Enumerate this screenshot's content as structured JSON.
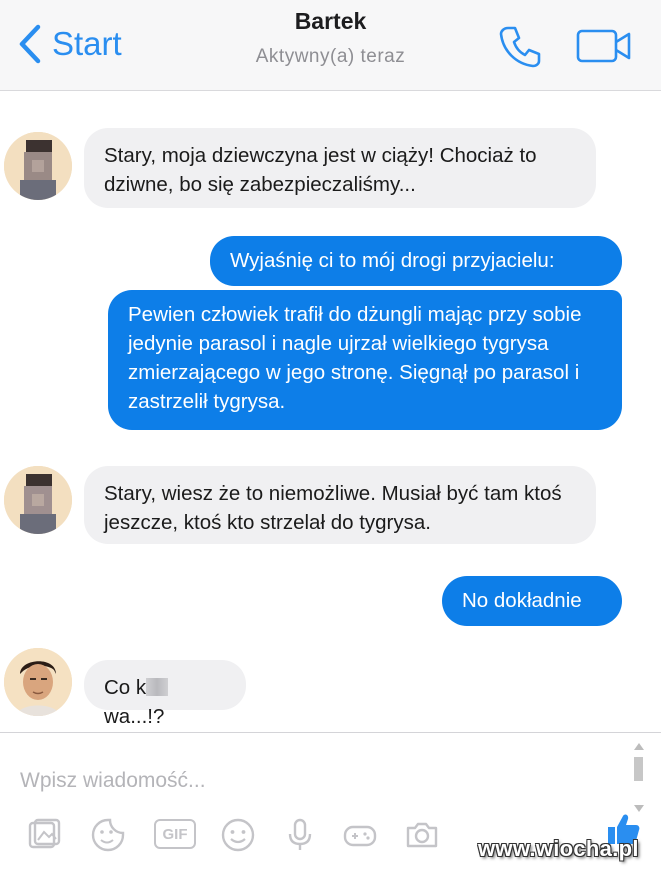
{
  "header": {
    "back_label": "Start",
    "contact_name": "Bartek",
    "status": "Aktywny(a) teraz",
    "icons": [
      "chevron-left-icon",
      "phone-icon",
      "video-camera-icon"
    ]
  },
  "messages": [
    {
      "from": "contact",
      "text": "Stary, moja dziewczyna jest w ciąży! Chociaż to dziwne, bo się zabezpieczaliśmy..."
    },
    {
      "from": "me",
      "text": "Wyjaśnię ci to mój drogi przyjacielu:"
    },
    {
      "from": "me",
      "text": "Pewien człowiek trafił do dżungli mając przy sobie jedynie parasol i nagle ujrzał wielkiego tygrysa zmierzającego w jego stronę. Sięgnął po parasol i zastrzelił tygrysa."
    },
    {
      "from": "contact",
      "text": "Stary, wiesz że to niemożliwe. Musiał być tam ktoś jeszcze, ktoś kto strzelał do tygrysa."
    },
    {
      "from": "me",
      "text": "No dokładnie"
    },
    {
      "from": "contact",
      "text_before": "Co k",
      "text_after": "wa...!?"
    }
  ],
  "composer": {
    "placeholder": "Wpisz wiadomość...",
    "gif_label": "GIF",
    "toolbar_icons": [
      "image-icon",
      "sticker-icon",
      "gif-icon",
      "emoji-icon",
      "microphone-icon",
      "gamepad-icon",
      "camera-icon",
      "like-icon"
    ]
  },
  "watermark": "www.wiocha.pl",
  "colors": {
    "accent": "#0d7ee8",
    "incoming_bubble": "#f0f0f2",
    "header_bg": "#f7f7f8"
  }
}
